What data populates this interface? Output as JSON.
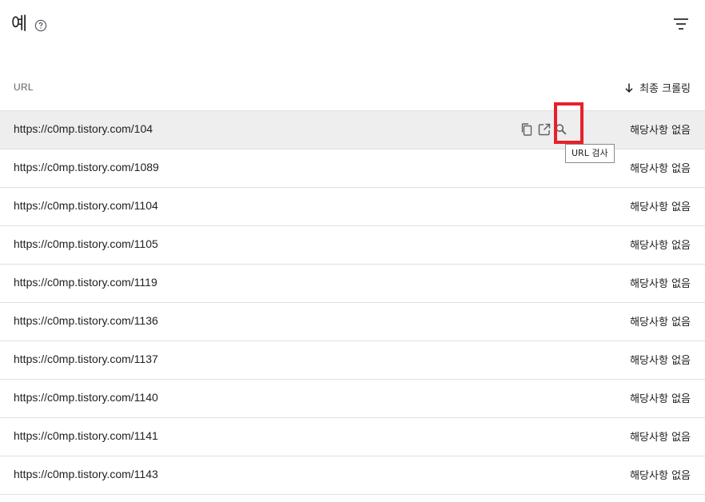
{
  "header": {
    "title": "예",
    "help_icon": "help-circle-icon",
    "filter_icon": "filter-list-icon"
  },
  "columns": {
    "url": "URL",
    "last_crawl": "최종 크롤링",
    "sort_icon": "arrow-down-icon",
    "sort_direction": "descending"
  },
  "rows": [
    {
      "url": "https://c0mp.tistory.com/104",
      "last_crawl": "해당사항 없음"
    },
    {
      "url": "https://c0mp.tistory.com/1089",
      "last_crawl": "해당사항 없음"
    },
    {
      "url": "https://c0mp.tistory.com/1104",
      "last_crawl": "해당사항 없음"
    },
    {
      "url": "https://c0mp.tistory.com/1105",
      "last_crawl": "해당사항 없음"
    },
    {
      "url": "https://c0mp.tistory.com/1119",
      "last_crawl": "해당사항 없음"
    },
    {
      "url": "https://c0mp.tistory.com/1136",
      "last_crawl": "해당사항 없음"
    },
    {
      "url": "https://c0mp.tistory.com/1137",
      "last_crawl": "해당사항 없음"
    },
    {
      "url": "https://c0mp.tistory.com/1140",
      "last_crawl": "해당사항 없음"
    },
    {
      "url": "https://c0mp.tistory.com/1141",
      "last_crawl": "해당사항 없음"
    },
    {
      "url": "https://c0mp.tistory.com/1143",
      "last_crawl": "해당사항 없음"
    }
  ],
  "row_actions": {
    "copy_icon": "copy-icon",
    "open_icon": "open-in-new-icon",
    "inspect_icon": "search-icon"
  },
  "tooltip": {
    "text": "URL 검사"
  },
  "colors": {
    "highlight": "#e8202a",
    "hover_row": "#eeeeee",
    "divider": "#e0e0e0",
    "icon": "#5f6368"
  }
}
